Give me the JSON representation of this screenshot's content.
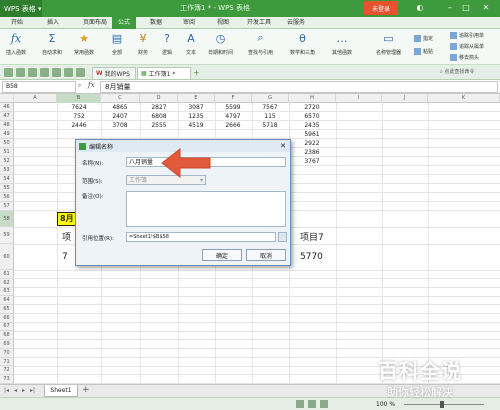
{
  "title_bar": {
    "app_name": "WPS 表格",
    "window_title": "工作簿1 * - WPS 表格",
    "login_label": "未登录"
  },
  "menu": {
    "items": [
      "开始",
      "插入",
      "页面布局",
      "公式",
      "数据",
      "审阅",
      "视图",
      "开发工具",
      "云服务"
    ],
    "active_index": 3
  },
  "toolbar": {
    "insert_function": "插入函数",
    "autosum": "自动求和",
    "common_functions": "常用函数",
    "all": "全部",
    "finance": "财务",
    "logic": "逻辑",
    "text": "文本",
    "datetime": "日期和时间",
    "lookup": "查找与引用",
    "math_trig": "数学和三角",
    "other_functions": "其他函数",
    "name_manager": "名称管理器",
    "paste": "粘贴",
    "specify": "指定",
    "trace_precedents": "追踪引用单",
    "trace_dependents": "追踪从属单",
    "remove_arrows": "移去箭头"
  },
  "tabs": {
    "wps_home": "我的WPS",
    "workbook": "工作簿1 *"
  },
  "tabbar_right": "点此查找命令",
  "formula_bar": {
    "name_box": "B58",
    "fx_symbol": "fx",
    "content": "8月销量"
  },
  "columns": [
    "A",
    "B",
    "C",
    "D",
    "E",
    "F",
    "G",
    "H",
    "I",
    "J",
    "K"
  ],
  "rows": [
    {
      "num": "46",
      "values": [
        "7624",
        "4865",
        "2827",
        "3087",
        "5599",
        "7567",
        "2720"
      ]
    },
    {
      "num": "47",
      "values": [
        "752",
        "2407",
        "6808",
        "1235",
        "4797",
        "115",
        "6570"
      ]
    },
    {
      "num": "48",
      "values": [
        "2446",
        "3708",
        "2555",
        "4519",
        "2666",
        "5718",
        "2435"
      ]
    },
    {
      "num": "49",
      "values": [
        "",
        "",
        "",
        "",
        "",
        "",
        "5961"
      ]
    },
    {
      "num": "50",
      "values": [
        "",
        "",
        "",
        "",
        "",
        "",
        "2922"
      ]
    },
    {
      "num": "51",
      "values": [
        "",
        "",
        "",
        "",
        "",
        "",
        "2386"
      ]
    },
    {
      "num": "52",
      "values": [
        "",
        "",
        "",
        "",
        "",
        "",
        "3767"
      ]
    },
    {
      "num": "53",
      "values": [
        "",
        "",
        "",
        "",
        "",
        "",
        ""
      ]
    },
    {
      "num": "54",
      "values": [
        "",
        "",
        "",
        "",
        "",
        "",
        ""
      ]
    },
    {
      "num": "55",
      "values": [
        "",
        "",
        "",
        "",
        "",
        "",
        ""
      ]
    },
    {
      "num": "56",
      "values": [
        "",
        "",
        "",
        "",
        "",
        "",
        ""
      ]
    },
    {
      "num": "57",
      "values": [
        "",
        "",
        "",
        "",
        "",
        "",
        ""
      ]
    }
  ],
  "row58": {
    "num": "58",
    "b": "8月"
  },
  "row59": {
    "num": "59",
    "b": "项",
    "h": "项目7"
  },
  "row60": {
    "num": "60",
    "b": "7",
    "h": "5770"
  },
  "lower_rows": [
    "61",
    "62",
    "63",
    "64",
    "65",
    "66",
    "67",
    "68",
    "69",
    "70",
    "71",
    "72",
    "73"
  ],
  "dialog": {
    "title": "编辑名称",
    "name_label": "名称(N):",
    "name_value": "八月销量",
    "scope_label": "范围(S):",
    "scope_value": "工作簿",
    "note_label": "备注(O):",
    "ref_label": "引用位置(R):",
    "ref_value": "=Sheet1!$B$58",
    "ok": "确定",
    "cancel": "取消"
  },
  "sheet_tab": "Sheet1",
  "status": {
    "zoom": "100 %"
  },
  "watermark": {
    "line1": "百科全说",
    "line2": "助你轻松解决"
  },
  "colors": {
    "accent": "#3d9b3d",
    "login": "#e5522d",
    "arrow": "#e15b3b",
    "highlight": "#ffff00"
  }
}
